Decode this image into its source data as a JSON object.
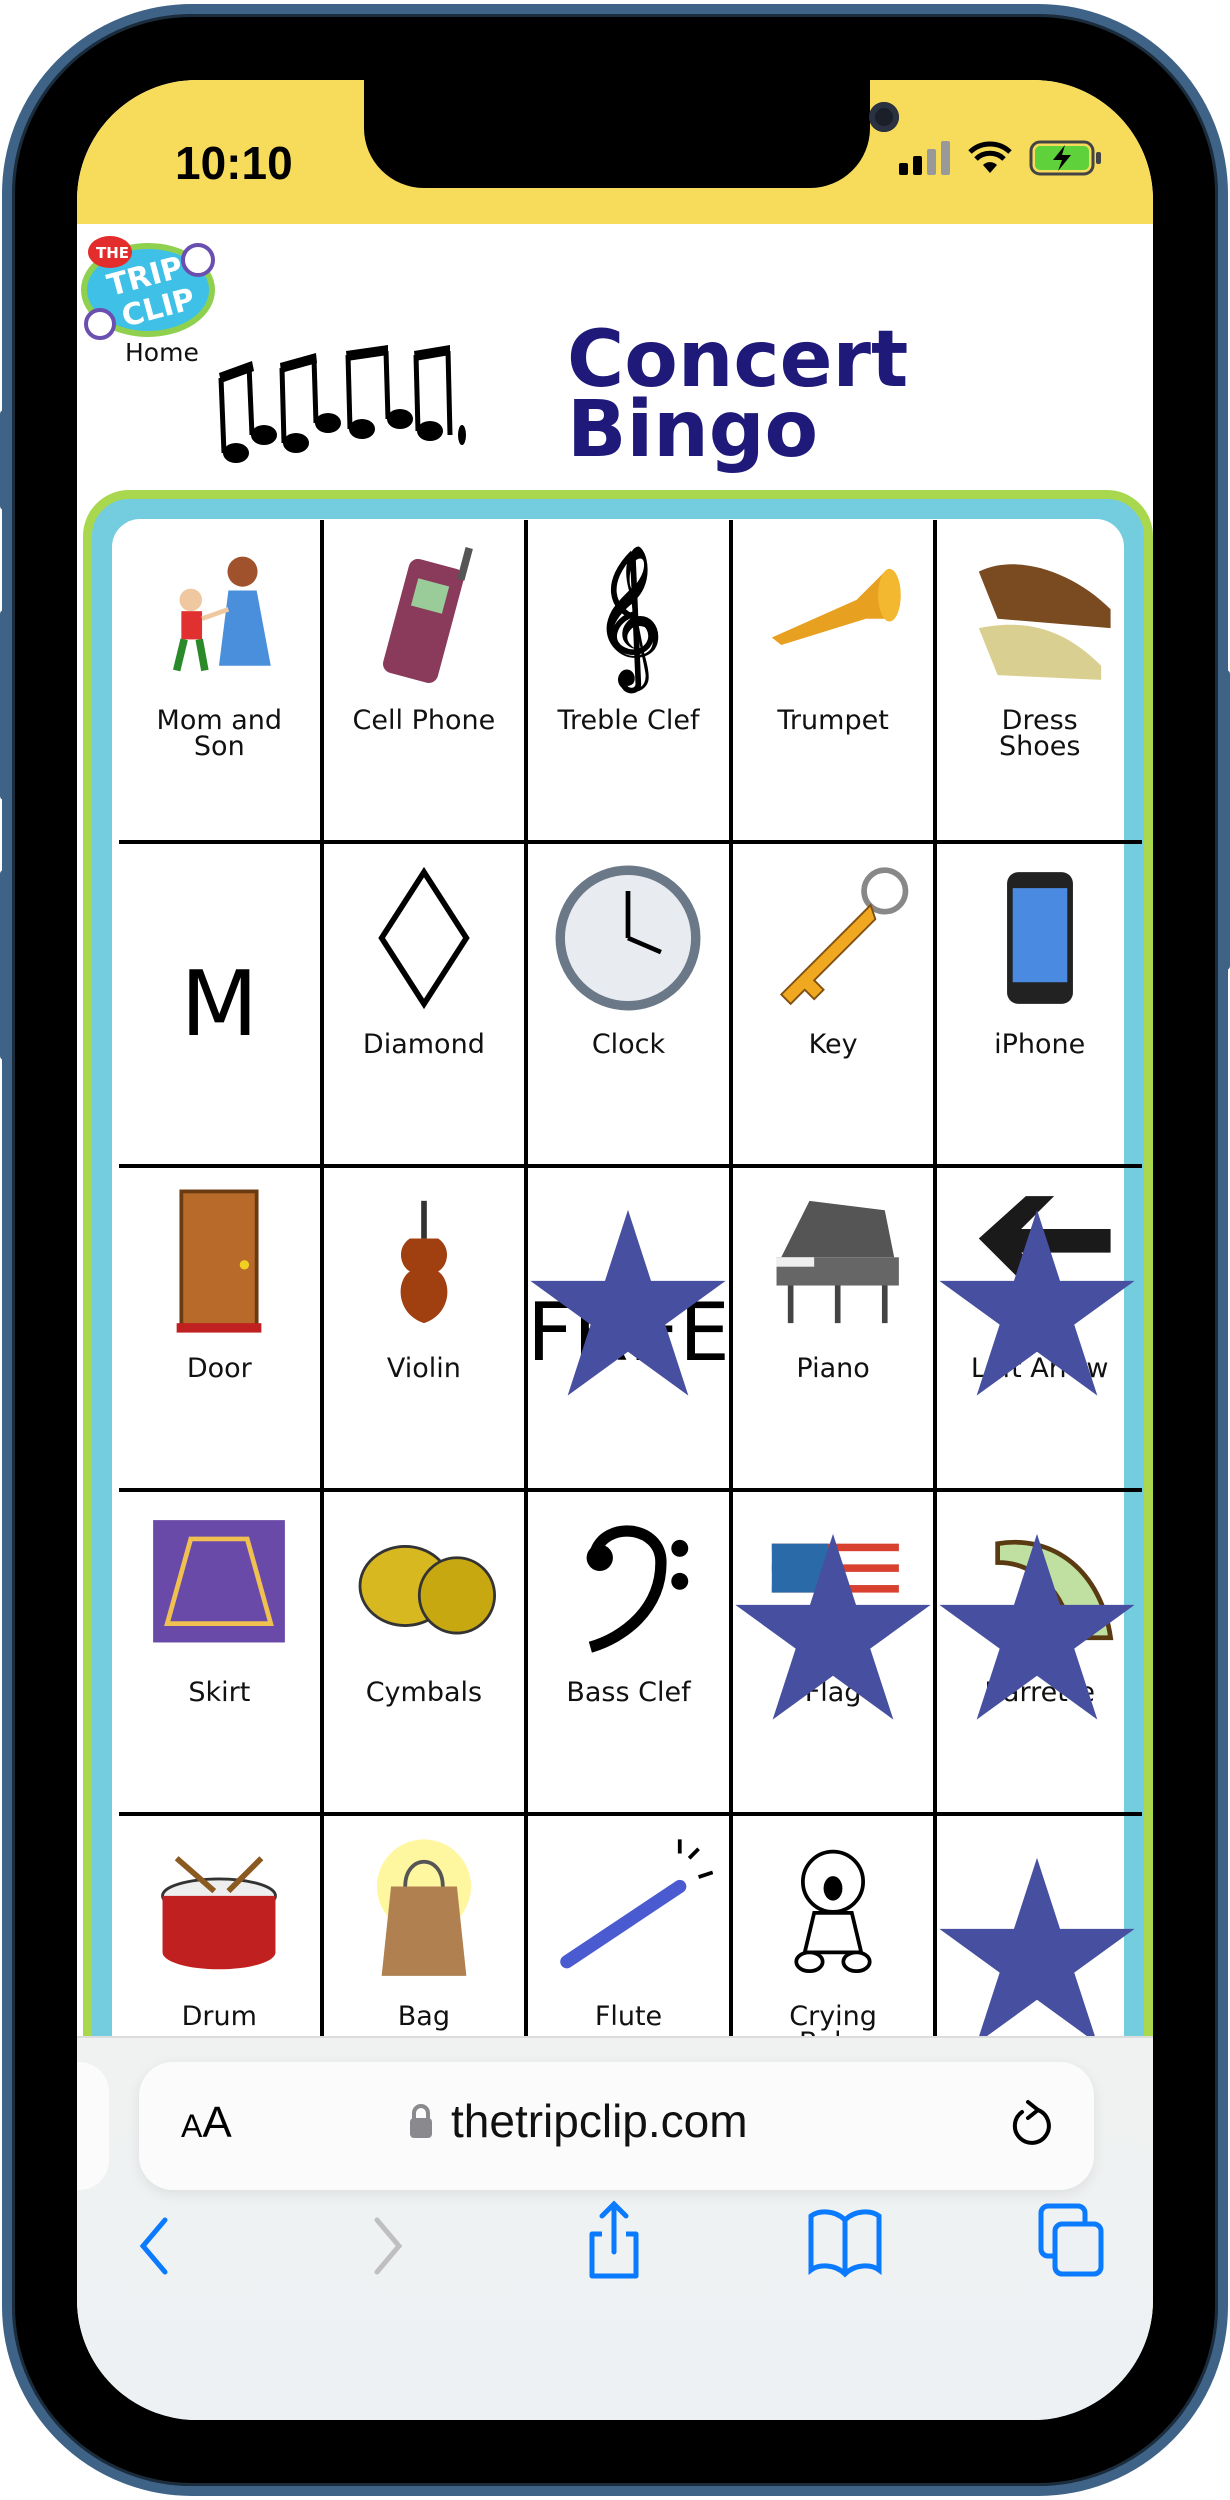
{
  "status_bar": {
    "time": "10:10",
    "battery": "charging",
    "signal_bars": 2
  },
  "header": {
    "logo_text": "THE TRIP CLIP",
    "home_link": "Home",
    "title_line1": "Concert",
    "title_line2": "Bingo"
  },
  "colors": {
    "status_bg": "#f7dc5c",
    "title": "#1f1a7a",
    "board_outer": "#a9d84f",
    "board_inner": "#74cddf",
    "star": "#474fa0",
    "accent": "#0a7aff"
  },
  "cells": [
    {
      "label": "Mom and Son",
      "icon": "mom-and-son-icon",
      "starred": false
    },
    {
      "label": "Cell Phone",
      "icon": "cell-phone-icon",
      "starred": false
    },
    {
      "label": "Treble Clef",
      "icon": "treble-clef-icon",
      "starred": false
    },
    {
      "label": "Trumpet",
      "icon": "trumpet-icon",
      "starred": false
    },
    {
      "label": "Dress Shoes",
      "icon": "dress-shoes-icon",
      "starred": false
    },
    {
      "label": "",
      "letter": "M",
      "icon": "letter-m",
      "starred": false
    },
    {
      "label": "Diamond",
      "icon": "diamond-icon",
      "starred": false
    },
    {
      "label": "Clock",
      "icon": "clock-icon",
      "starred": false
    },
    {
      "label": "Key",
      "icon": "key-icon",
      "starred": false
    },
    {
      "label": "iPhone",
      "icon": "iphone-icon",
      "starred": false
    },
    {
      "label": "Door",
      "icon": "door-icon",
      "starred": false
    },
    {
      "label": "Violin",
      "icon": "violin-icon",
      "starred": false
    },
    {
      "label": "",
      "letter": "FREE",
      "icon": "free-space",
      "starred": true
    },
    {
      "label": "Piano",
      "icon": "piano-icon",
      "starred": false
    },
    {
      "label": "Left Arrow",
      "icon": "left-arrow-icon",
      "starred": true
    },
    {
      "label": "Skirt",
      "icon": "skirt-icon",
      "starred": false
    },
    {
      "label": "Cymbals",
      "icon": "cymbals-icon",
      "starred": false
    },
    {
      "label": "Bass Clef",
      "icon": "bass-clef-icon",
      "starred": false
    },
    {
      "label": "Flag",
      "icon": "flag-icon",
      "starred": true
    },
    {
      "label": "Barrette",
      "icon": "barrette-icon",
      "starred": true
    },
    {
      "label": "Drum",
      "icon": "drum-icon",
      "starred": false
    },
    {
      "label": "Bag",
      "icon": "bag-icon",
      "starred": false
    },
    {
      "label": "Flute",
      "icon": "flute-icon",
      "starred": false
    },
    {
      "label": "Crying Baby",
      "icon": "crying-baby-icon",
      "starred": false
    },
    {
      "label": "",
      "icon": "hidden-item-icon",
      "starred": true
    }
  ],
  "browser": {
    "aa_label_small": "A",
    "aa_label_large": "A",
    "url": "thetripclip.com",
    "back_enabled": true,
    "forward_enabled": false
  }
}
